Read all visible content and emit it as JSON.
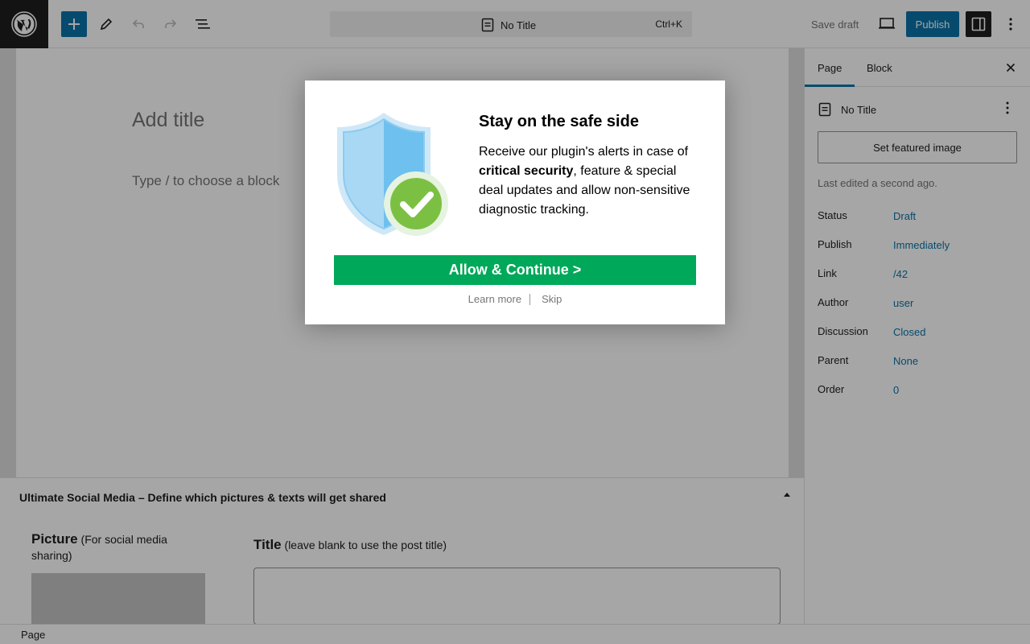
{
  "toolbar": {
    "document_title": "No Title",
    "shortcut": "Ctrl+K",
    "save_draft": "Save draft",
    "publish": "Publish"
  },
  "editor": {
    "title_placeholder": "Add title",
    "block_placeholder": "Type / to choose a block"
  },
  "metabox": {
    "title": "Ultimate Social Media – Define which pictures & texts will get shared",
    "picture_label": "Picture",
    "picture_hint": "(For social media sharing)",
    "title_label": "Title",
    "title_hint": "(leave blank to use the post title)"
  },
  "sidebar": {
    "tabs": [
      "Page",
      "Block"
    ],
    "document_name": "No Title",
    "featured_image_button": "Set featured image",
    "last_edited": "Last edited a second ago.",
    "meta": [
      {
        "label": "Status",
        "value": "Draft"
      },
      {
        "label": "Publish",
        "value": "Immediately"
      },
      {
        "label": "Link",
        "value": "/42"
      },
      {
        "label": "Author",
        "value": "user"
      },
      {
        "label": "Discussion",
        "value": "Closed"
      },
      {
        "label": "Parent",
        "value": "None"
      },
      {
        "label": "Order",
        "value": "0"
      }
    ]
  },
  "statusbar": {
    "breadcrumb": "Page"
  },
  "modal": {
    "heading": "Stay on the safe side",
    "body_before": "Receive our plugin's alerts in case of ",
    "body_bold": "critical security",
    "body_after": ", feature & special deal updates and allow non-sensitive diagnostic tracking.",
    "allow_button": "Allow & Continue >",
    "learn_more": "Learn more",
    "skip": "Skip"
  },
  "colors": {
    "accent": "#0a73aa",
    "allow_green": "#00a859",
    "dark": "#1e1e1e"
  }
}
